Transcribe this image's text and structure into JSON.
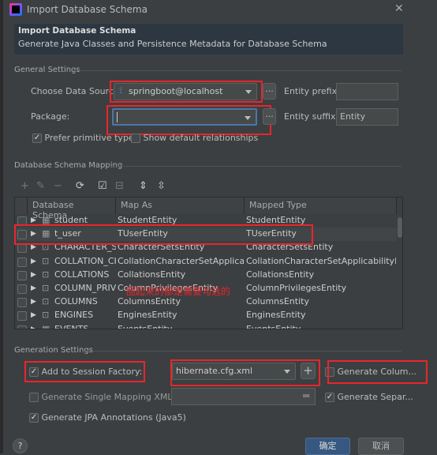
{
  "window": {
    "title": "Import Database Schema"
  },
  "header": {
    "title": "Import Database Schema",
    "subtitle": "Generate Java Classes and Persistence Metadata for Database Schema"
  },
  "general": {
    "section": "General Settings",
    "data_source_label": "Choose Data Source:",
    "data_source_value": "springboot@localhost",
    "package_label": "Package:",
    "package_value": "",
    "browse": "...",
    "entity_prefix_label": "Entity prefix:",
    "entity_prefix_value": "",
    "entity_suffix_label": "Entity suffix:",
    "entity_suffix_value": "Entity",
    "prefer_primitive": {
      "label": "Prefer primitive types",
      "checked": true
    },
    "show_default": {
      "label": "Show default relationships",
      "checked": false
    }
  },
  "mapping": {
    "section": "Database Schema Mapping",
    "columns": [
      "Database Schema",
      "Map As",
      "Mapped Type"
    ],
    "rows": [
      {
        "schema": "student",
        "map_as": "StudentEntity",
        "type": "StudentEntity",
        "icon": "table"
      },
      {
        "schema": "t_user",
        "map_as": "TUserEntity",
        "type": "TUserEntity",
        "icon": "table"
      },
      {
        "schema": "CHARACTER_SET",
        "map_as": "CharacterSetsEntity",
        "type": "CharacterSetsEntity",
        "icon": "view"
      },
      {
        "schema": "COLLATION_CHA",
        "map_as": "CollationCharacterSetApplicabili...",
        "type": "CollationCharacterSetApplicabilityEntity",
        "icon": "view"
      },
      {
        "schema": "COLLATIONS",
        "map_as": "CollationsEntity",
        "type": "CollationsEntity",
        "icon": "view"
      },
      {
        "schema": "COLUMN_PRIVILI",
        "map_as": "ColumnPrivilegesEntity",
        "type": "ColumnPrivilegesEntity",
        "icon": "view"
      },
      {
        "schema": "COLUMNS",
        "map_as": "ColumnsEntity",
        "type": "ColumnsEntity",
        "icon": "view"
      },
      {
        "schema": "ENGINES",
        "map_as": "EnginesEntity",
        "type": "EnginesEntity",
        "icon": "view"
      },
      {
        "schema": "EVENTS",
        "map_as": "EventsEntity",
        "type": "EventsEntity",
        "icon": "table"
      }
    ],
    "annotation": "圈起来的都是需要勾选的"
  },
  "generation": {
    "section": "Generation Settings",
    "session_factory": {
      "label": "Add to Session Factory:",
      "checked": true,
      "value": "hibernate.cfg.xml"
    },
    "single_xml": {
      "label": "Generate Single Mapping XML:",
      "checked": false,
      "value": ""
    },
    "jpa": {
      "label": "Generate JPA Annotations (Java5)",
      "checked": true
    },
    "gen_column": {
      "label": "Generate Colum...",
      "checked": false
    },
    "gen_separate": {
      "label": "Generate Separ...",
      "checked": true
    }
  },
  "footer": {
    "help": "?",
    "ok": "确定",
    "cancel": "取消"
  },
  "colors": {
    "accent": "#365880",
    "annotation": "#e8262b",
    "background": "#3c3f41"
  }
}
